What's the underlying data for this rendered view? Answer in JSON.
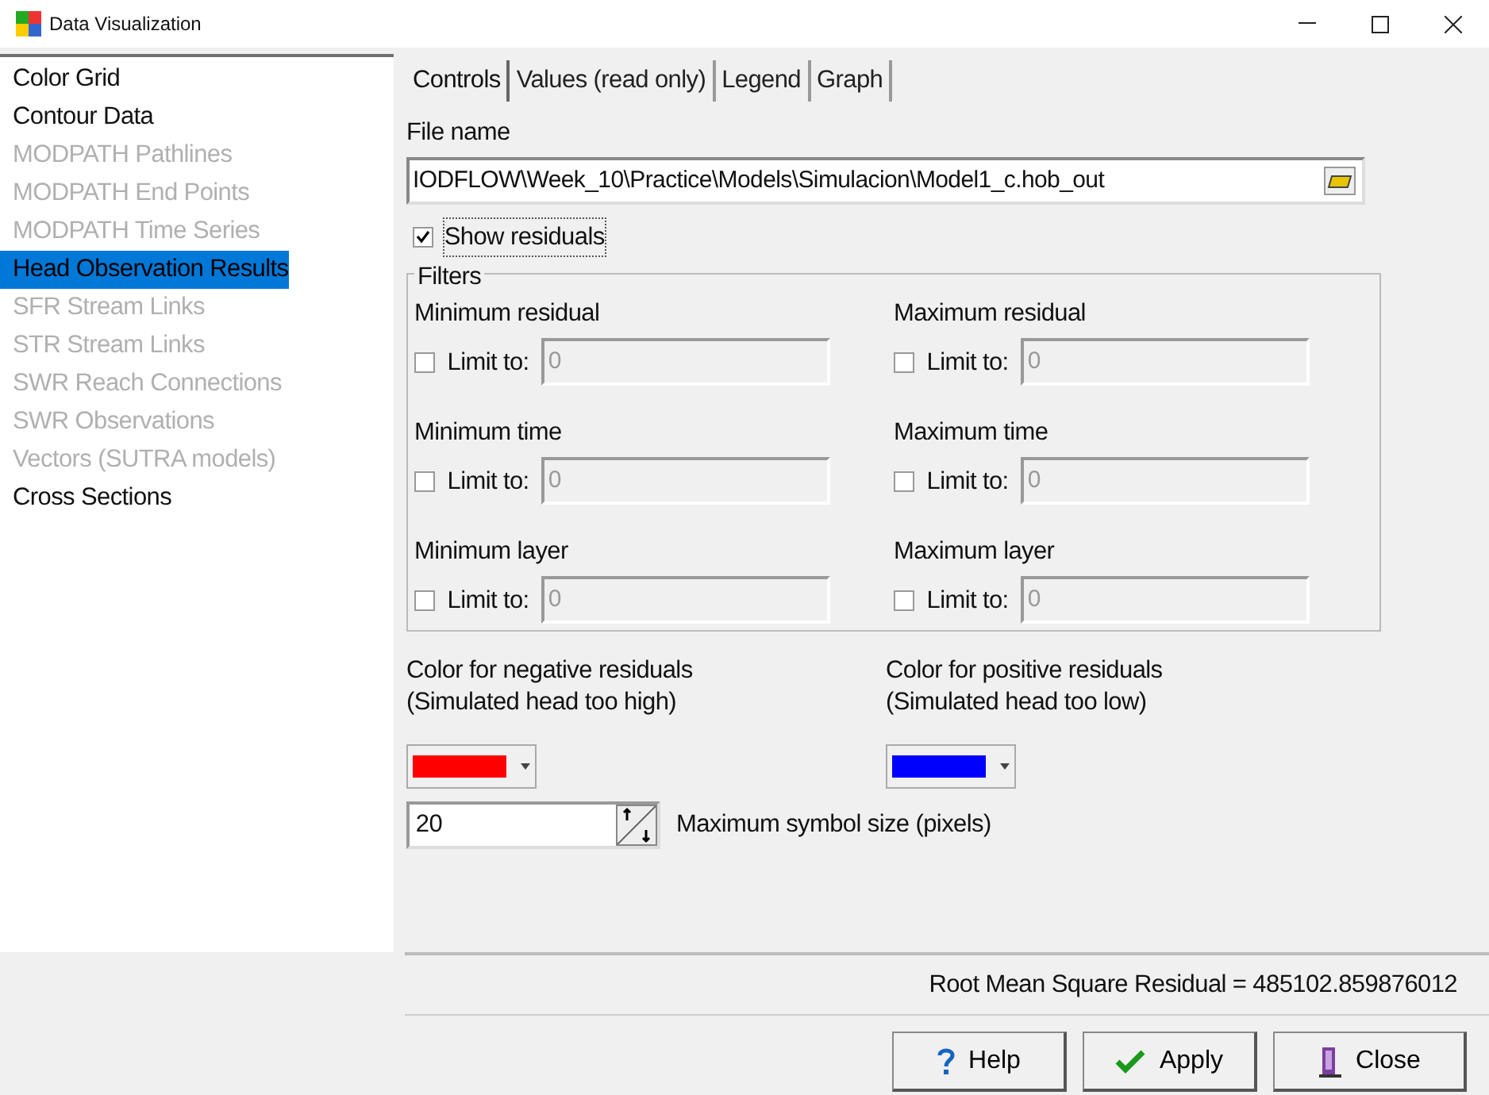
{
  "window": {
    "title": "Data Visualization"
  },
  "sidebar": {
    "items": [
      {
        "label": "Color Grid",
        "disabled": false,
        "selected": false
      },
      {
        "label": "Contour Data",
        "disabled": false,
        "selected": false
      },
      {
        "label": "MODPATH Pathlines",
        "disabled": true,
        "selected": false
      },
      {
        "label": "MODPATH End Points",
        "disabled": true,
        "selected": false
      },
      {
        "label": "MODPATH Time Series",
        "disabled": true,
        "selected": false
      },
      {
        "label": "Head Observation Results",
        "disabled": false,
        "selected": true
      },
      {
        "label": "SFR Stream Links",
        "disabled": true,
        "selected": false
      },
      {
        "label": "STR Stream Links",
        "disabled": true,
        "selected": false
      },
      {
        "label": "SWR Reach Connections",
        "disabled": true,
        "selected": false
      },
      {
        "label": "SWR Observations",
        "disabled": true,
        "selected": false
      },
      {
        "label": "Vectors (SUTRA models)",
        "disabled": true,
        "selected": false
      },
      {
        "label": "Cross Sections",
        "disabled": false,
        "selected": false
      }
    ]
  },
  "tabs": [
    {
      "label": "Controls",
      "selected": true
    },
    {
      "label": "Values (read only)",
      "selected": false
    },
    {
      "label": "Legend",
      "selected": false
    },
    {
      "label": "Graph",
      "selected": false
    }
  ],
  "file_name": {
    "label": "File name",
    "value": "IODFLOW\\Week_10\\Practice\\Models\\Simulacion\\Model1_c.hob_out"
  },
  "show_residuals": {
    "label": "Show residuals",
    "checked": true
  },
  "filters": {
    "title": "Filters",
    "items": [
      {
        "label": "Minimum residual",
        "limit_label": "Limit to:",
        "checked": false,
        "value": "0"
      },
      {
        "label": "Maximum residual",
        "limit_label": "Limit to:",
        "checked": false,
        "value": "0"
      },
      {
        "label": "Minimum time",
        "limit_label": "Limit to:",
        "checked": false,
        "value": "0"
      },
      {
        "label": "Maximum time",
        "limit_label": "Limit to:",
        "checked": false,
        "value": "0"
      },
      {
        "label": "Minimum layer",
        "limit_label": "Limit to:",
        "checked": false,
        "value": "0"
      },
      {
        "label": "Maximum layer",
        "limit_label": "Limit to:",
        "checked": false,
        "value": "0"
      }
    ]
  },
  "colors": [
    {
      "label": "Color for negative residuals\n(Simulated head too high)",
      "color": "#ff0000"
    },
    {
      "label": "Color for positive residuals\n(Simulated head too low)",
      "color": "#0000ff"
    }
  ],
  "symbol_size": {
    "value": "20",
    "label": "Maximum symbol size (pixels)"
  },
  "status": "Root Mean Square Residual = 485102.859876012",
  "buttons": [
    {
      "label": "Help",
      "kind": "help"
    },
    {
      "label": "Apply",
      "kind": "apply"
    },
    {
      "label": "Close",
      "kind": "close"
    }
  ]
}
